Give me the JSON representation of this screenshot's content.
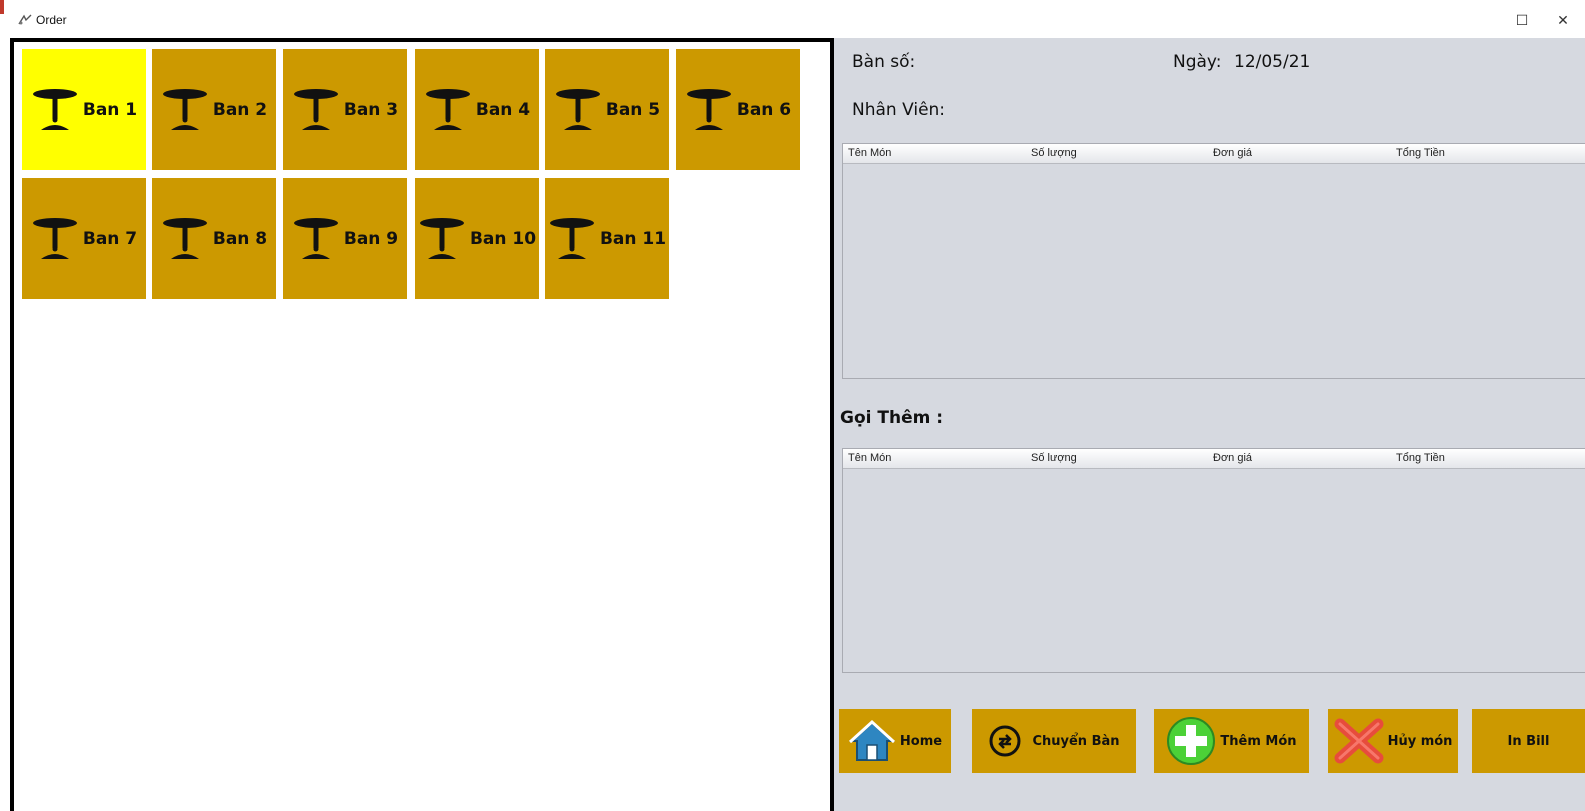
{
  "window": {
    "title": "Order",
    "maximize_glyph": "☐",
    "close_glyph": "✕"
  },
  "tables": [
    {
      "label": "Ban 1",
      "active": true
    },
    {
      "label": "Ban 2",
      "active": false
    },
    {
      "label": "Ban 3",
      "active": false
    },
    {
      "label": "Ban 4",
      "active": false
    },
    {
      "label": "Ban 5",
      "active": false
    },
    {
      "label": "Ban 6",
      "active": false
    },
    {
      "label": "Ban 7",
      "active": false
    },
    {
      "label": "Ban 8",
      "active": false
    },
    {
      "label": "Ban 9",
      "active": false
    },
    {
      "label": "Ban 10",
      "active": false
    },
    {
      "label": "Ban 11",
      "active": false
    }
  ],
  "info": {
    "table_no_label": "Bàn số:",
    "date_label": "Ngày:",
    "date_value": "12/05/21",
    "staff_label": "Nhân Viên:"
  },
  "order_grid": {
    "columns": [
      "Tên Món",
      "Số lượng",
      "Đơn giá",
      "Tổng Tiền"
    ],
    "rows": []
  },
  "extra": {
    "title": "Gọi Thêm :",
    "columns": [
      "Tên Món",
      "Số lượng",
      "Đơn giá",
      "Tổng Tiền"
    ],
    "rows": []
  },
  "actions": {
    "home": "Home",
    "transfer": "Chuyển Bàn",
    "add_item": "Thêm Món",
    "cancel_item": "Hủy món",
    "print_bill": "In Bill"
  },
  "colors": {
    "tile": "#cc9900",
    "tile_active": "#ffff00",
    "panel": "#d6d9e0",
    "border": "#000000"
  },
  "icons": {
    "table": "table-icon",
    "home": "home-icon",
    "transfer": "transfer-icon",
    "add": "add-icon",
    "cancel": "cancel-icon",
    "app": "app-icon"
  }
}
